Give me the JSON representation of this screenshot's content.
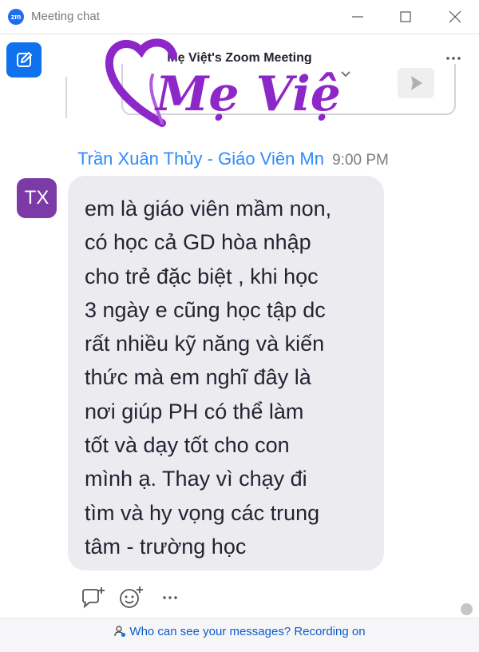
{
  "window": {
    "app_icon_text": "zm",
    "title": "Meeting chat"
  },
  "header": {
    "meeting_title": "Mẹ Việt's Zoom Meeting"
  },
  "brand": {
    "logo_text": "Mẹ Việt",
    "color": "#8e27c9"
  },
  "message": {
    "sender": "Trần Xuân Thủy - Giáo Viên Mn",
    "time": "9:00 PM",
    "avatar_initials": "TX",
    "avatar_color": "#7b3aa6",
    "text": "em là giáo viên mầm non,\ncó học cả GD hòa nhập\ncho trẻ đặc biệt , khi học\n3 ngày e cũng học tập dc\nrất nhiều kỹ năng và kiến\nthức mà em nghĩ đây là\nnơi giúp PH có thể làm\ntốt và dạy tốt cho con\nmình ạ. Thay vì chạy đi\ntìm và hy vọng các trung\ntâm - trường học"
  },
  "footer": {
    "notice": "Who can see your messages? Recording on"
  },
  "colors": {
    "accent": "#0e72ed",
    "sender_name": "#2d8cff",
    "bubble": "#ececf0"
  }
}
